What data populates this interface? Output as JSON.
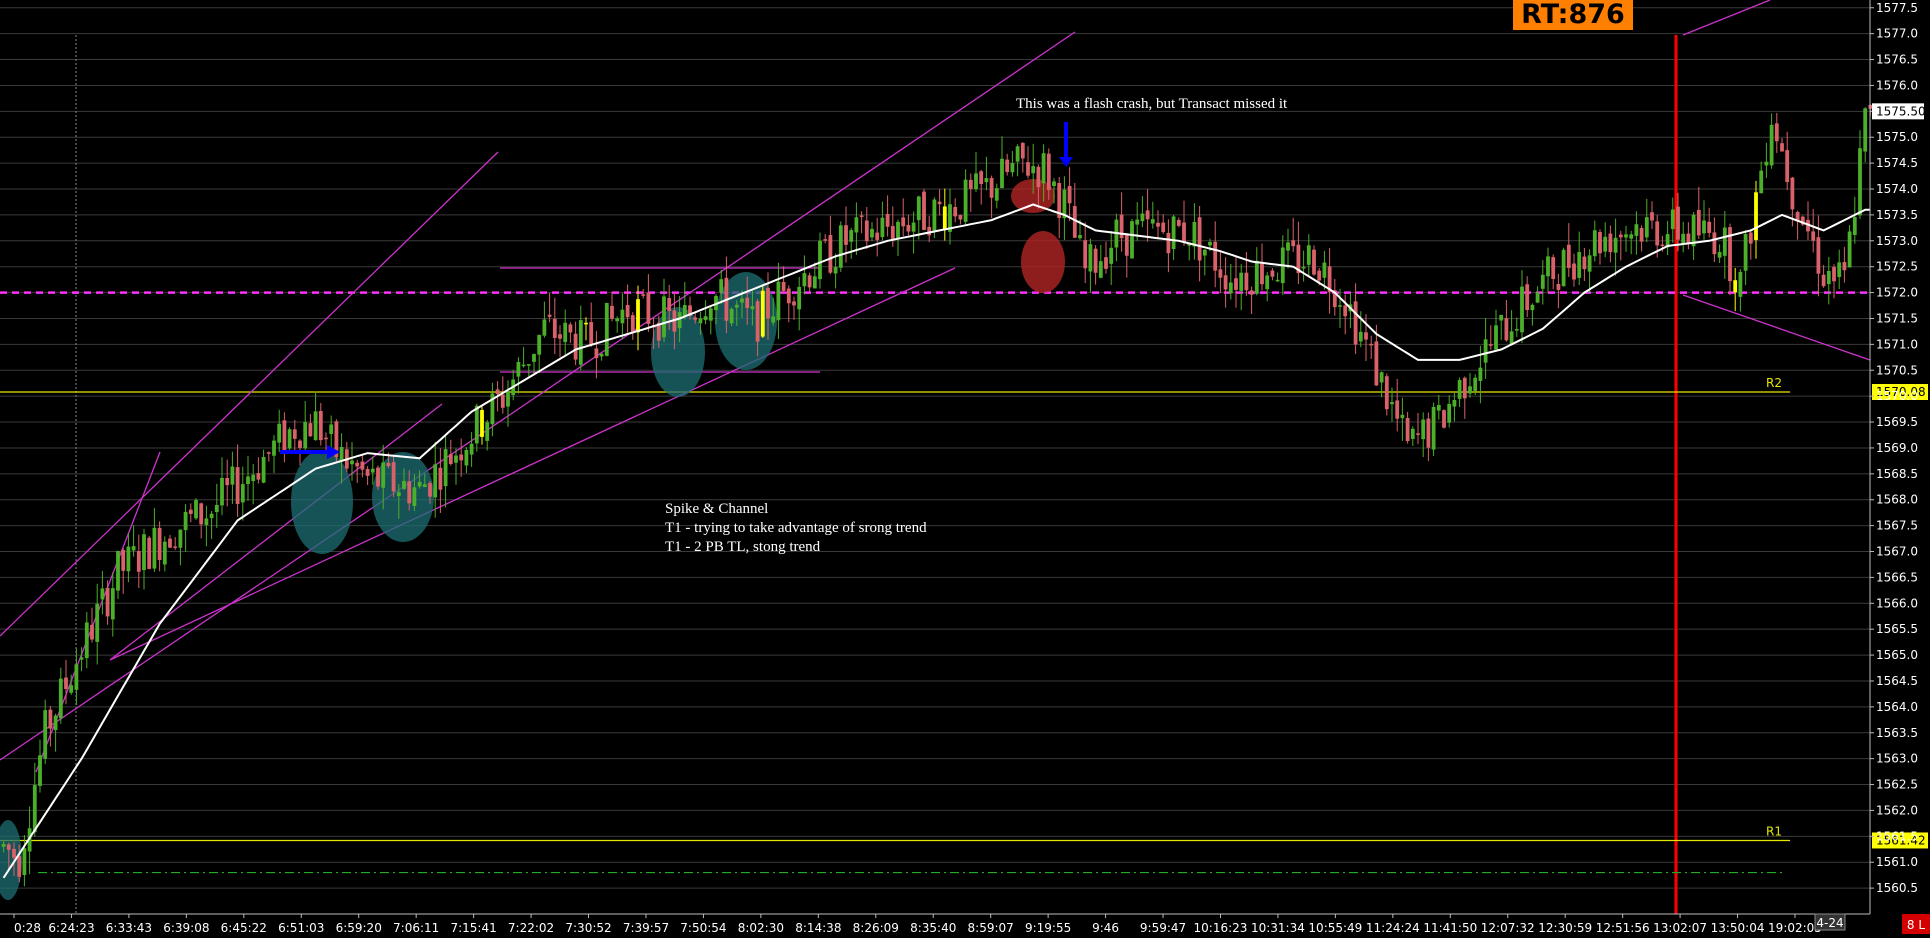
{
  "chart_data": {
    "type": "candlestick",
    "y_axis": {
      "range": [
        1560.0,
        1577.65
      ],
      "ticks": [
        "1560.5",
        "1561.0",
        "1561.5",
        "1562.0",
        "1562.5",
        "1563.0",
        "1563.5",
        "1564.0",
        "1564.5",
        "1565.0",
        "1565.5",
        "1566.0",
        "1566.5",
        "1567.0",
        "1567.5",
        "1568.0",
        "1568.5",
        "1569.0",
        "1569.5",
        "1570.0",
        "1570.5",
        "1571.0",
        "1571.5",
        "1572.0",
        "1572.5",
        "1573.0",
        "1573.5",
        "1574.0",
        "1574.5",
        "1575.0",
        "1575.5",
        "1576.0",
        "1576.5",
        "1577.0",
        "1577.5"
      ],
      "position": "right",
      "last_price_label": "1575.50",
      "last_price": 1575.5
    },
    "x_axis": {
      "ticks": [
        "0:28",
        "6:24:23",
        "6:33:43",
        "6:39:08",
        "6:45:22",
        "6:51:03",
        "6:59:20",
        "7:06:11",
        "7:15:41",
        "7:22:02",
        "7:30:52",
        "7:39:57",
        "7:50:54",
        "8:02:30",
        "8:14:38",
        "8:26:09",
        "8:35:40",
        "8:59:07",
        "9:19:55",
        "9:46",
        "9:59:47",
        "10:16:23",
        "10:31:34",
        "10:55:49",
        "11:24:24",
        "11:41:50",
        "12:07:32",
        "12:30:59",
        "12:51:56",
        "13:02:07",
        "13:50:04",
        "19:02:05"
      ],
      "page_label": "4-24",
      "corner_badge": "8 L"
    },
    "price_path": [
      [
        0,
        1561.3
      ],
      [
        3,
        1561.1
      ],
      [
        8,
        1563.5
      ],
      [
        14,
        1564.9
      ],
      [
        22,
        1566.6
      ],
      [
        32,
        1567.4
      ],
      [
        40,
        1567.8
      ],
      [
        50,
        1568.8
      ],
      [
        56,
        1569.4
      ],
      [
        60,
        1569.5
      ],
      [
        64,
        1568.9
      ],
      [
        70,
        1568.4
      ],
      [
        80,
        1568.2
      ],
      [
        90,
        1569.3
      ],
      [
        96,
        1570.0
      ],
      [
        104,
        1571.3
      ],
      [
        112,
        1571.0
      ],
      [
        120,
        1571.7
      ],
      [
        130,
        1571.4
      ],
      [
        136,
        1572.0
      ],
      [
        144,
        1571.4
      ],
      [
        152,
        1572.2
      ],
      [
        162,
        1573.0
      ],
      [
        174,
        1573.4
      ],
      [
        186,
        1573.8
      ],
      [
        196,
        1574.5
      ],
      [
        200,
        1574.4
      ],
      [
        204,
        1573.7
      ],
      [
        208,
        1572.4
      ],
      [
        214,
        1573.1
      ],
      [
        220,
        1573.2
      ],
      [
        228,
        1573.2
      ],
      [
        236,
        1572.3
      ],
      [
        244,
        1572.5
      ],
      [
        252,
        1572.7
      ],
      [
        258,
        1571.9
      ],
      [
        264,
        1570.5
      ],
      [
        270,
        1569.0
      ],
      [
        276,
        1569.5
      ],
      [
        282,
        1570.5
      ],
      [
        290,
        1571.5
      ],
      [
        298,
        1572.4
      ],
      [
        306,
        1573.0
      ],
      [
        314,
        1573.3
      ],
      [
        322,
        1573.2
      ],
      [
        330,
        1573.1
      ],
      [
        334,
        1572.2
      ],
      [
        340,
        1575.5
      ],
      [
        344,
        1574.0
      ],
      [
        350,
        1572.4
      ],
      [
        354,
        1572.2
      ],
      [
        358,
        1575.3
      ]
    ],
    "sma_path": [
      [
        0,
        1560.7
      ],
      [
        15,
        1563.0
      ],
      [
        30,
        1565.6
      ],
      [
        45,
        1567.6
      ],
      [
        60,
        1568.6
      ],
      [
        70,
        1568.9
      ],
      [
        80,
        1568.8
      ],
      [
        90,
        1569.7
      ],
      [
        100,
        1570.3
      ],
      [
        110,
        1570.9
      ],
      [
        120,
        1571.2
      ],
      [
        130,
        1571.5
      ],
      [
        140,
        1571.9
      ],
      [
        150,
        1572.3
      ],
      [
        160,
        1572.7
      ],
      [
        170,
        1573.0
      ],
      [
        180,
        1573.2
      ],
      [
        190,
        1573.4
      ],
      [
        198,
        1573.7
      ],
      [
        204,
        1573.5
      ],
      [
        210,
        1573.2
      ],
      [
        218,
        1573.1
      ],
      [
        226,
        1573.0
      ],
      [
        234,
        1572.8
      ],
      [
        240,
        1572.6
      ],
      [
        248,
        1572.5
      ],
      [
        256,
        1572.0
      ],
      [
        264,
        1571.2
      ],
      [
        272,
        1570.7
      ],
      [
        280,
        1570.7
      ],
      [
        288,
        1570.9
      ],
      [
        296,
        1571.3
      ],
      [
        304,
        1572.0
      ],
      [
        312,
        1572.5
      ],
      [
        320,
        1572.9
      ],
      [
        328,
        1573.0
      ],
      [
        336,
        1573.2
      ],
      [
        342,
        1573.5
      ],
      [
        350,
        1573.2
      ],
      [
        358,
        1573.6
      ]
    ],
    "breakout_bars": [
      92,
      112,
      122,
      146,
      181,
      333,
      337
    ],
    "reference_lines": [
      {
        "name": "R2",
        "price": 1570.08,
        "label": "1570.08",
        "color": "#e6e600"
      },
      {
        "name": "R1",
        "price": 1561.42,
        "label": "1561.42",
        "color": "#e6e600"
      },
      {
        "name": "pivot",
        "price": 1572.0,
        "color": "#ff33ff",
        "style": "dashed"
      },
      {
        "name": "support",
        "price": 1560.8,
        "color": "#22aa22",
        "style": "dash-dot"
      }
    ],
    "markers": {
      "rt_label": "RT:876",
      "rt_color": "#ff7f00",
      "vertical_marker_color": "#ff0000"
    },
    "annotations": [
      {
        "lines": [
          "This was a flash crash, but Transact missed it"
        ]
      },
      {
        "lines": [
          "Spike & Channel",
          "T1 - trying to take advantage of srong trend",
          "T1 - 2 PB TL, stong trend"
        ]
      }
    ],
    "colors": {
      "up": "#4caf2a",
      "down": "#d9626a",
      "sma": "#ffffff",
      "highlight": "#ffff00",
      "trendline": "#cc33cc",
      "grid": "#3a3a3a",
      "ellipse_teal": "#1e6f73",
      "ellipse_red": "#b22626",
      "arrow": "#0000ff"
    }
  }
}
